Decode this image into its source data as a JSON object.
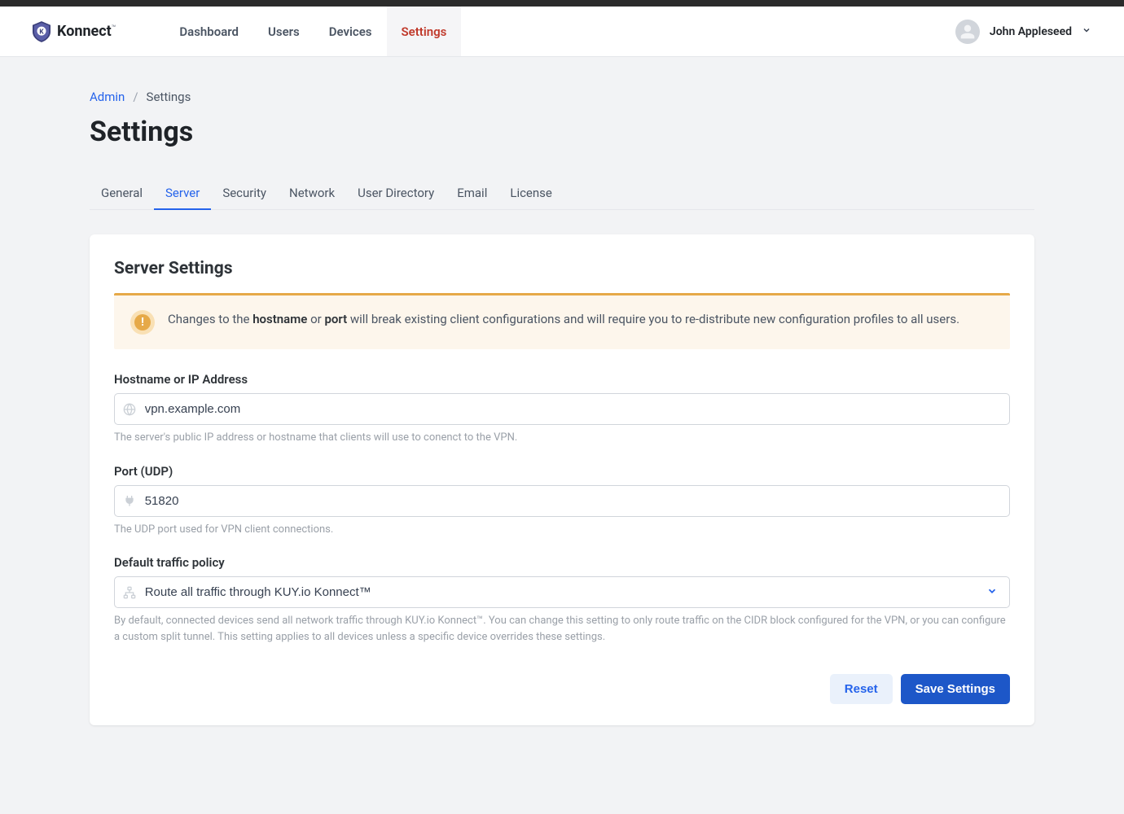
{
  "brand": {
    "name": "Konnect",
    "tm": "™"
  },
  "nav": {
    "items": [
      {
        "label": "Dashboard",
        "active": false
      },
      {
        "label": "Users",
        "active": false
      },
      {
        "label": "Devices",
        "active": false
      },
      {
        "label": "Settings",
        "active": true
      }
    ]
  },
  "user": {
    "name": "John Appleseed"
  },
  "breadcrumb": {
    "root": "Admin",
    "current": "Settings"
  },
  "page": {
    "title": "Settings"
  },
  "tabs": [
    {
      "label": "General",
      "active": false
    },
    {
      "label": "Server",
      "active": true
    },
    {
      "label": "Security",
      "active": false
    },
    {
      "label": "Network",
      "active": false
    },
    {
      "label": "User Directory",
      "active": false
    },
    {
      "label": "Email",
      "active": false
    },
    {
      "label": "License",
      "active": false
    }
  ],
  "card": {
    "title": "Server Settings",
    "alert": {
      "prefix": "Changes to the ",
      "b1": "hostname",
      "mid": " or ",
      "b2": "port",
      "suffix": " will break existing client configurations and will require you to re-distribute new configuration profiles to all users."
    },
    "fields": {
      "hostname": {
        "label": "Hostname or IP Address",
        "value": "vpn.example.com",
        "help": "The server's public IP address or hostname that clients will use to conenct to the VPN."
      },
      "port": {
        "label": "Port (UDP)",
        "value": "51820",
        "help": "The UDP port used for VPN client connections."
      },
      "traffic": {
        "label": "Default traffic policy",
        "value": "Route all traffic through KUY.io Konnect™",
        "help": "By default, connected devices send all network traffic through KUY.io Konnect™. You can change this setting to only route traffic on the CIDR block configured for the VPN, or you can configure a custom split tunnel. This setting applies to all devices unless a specific device overrides these settings."
      }
    },
    "actions": {
      "reset": "Reset",
      "save": "Save Settings"
    }
  }
}
